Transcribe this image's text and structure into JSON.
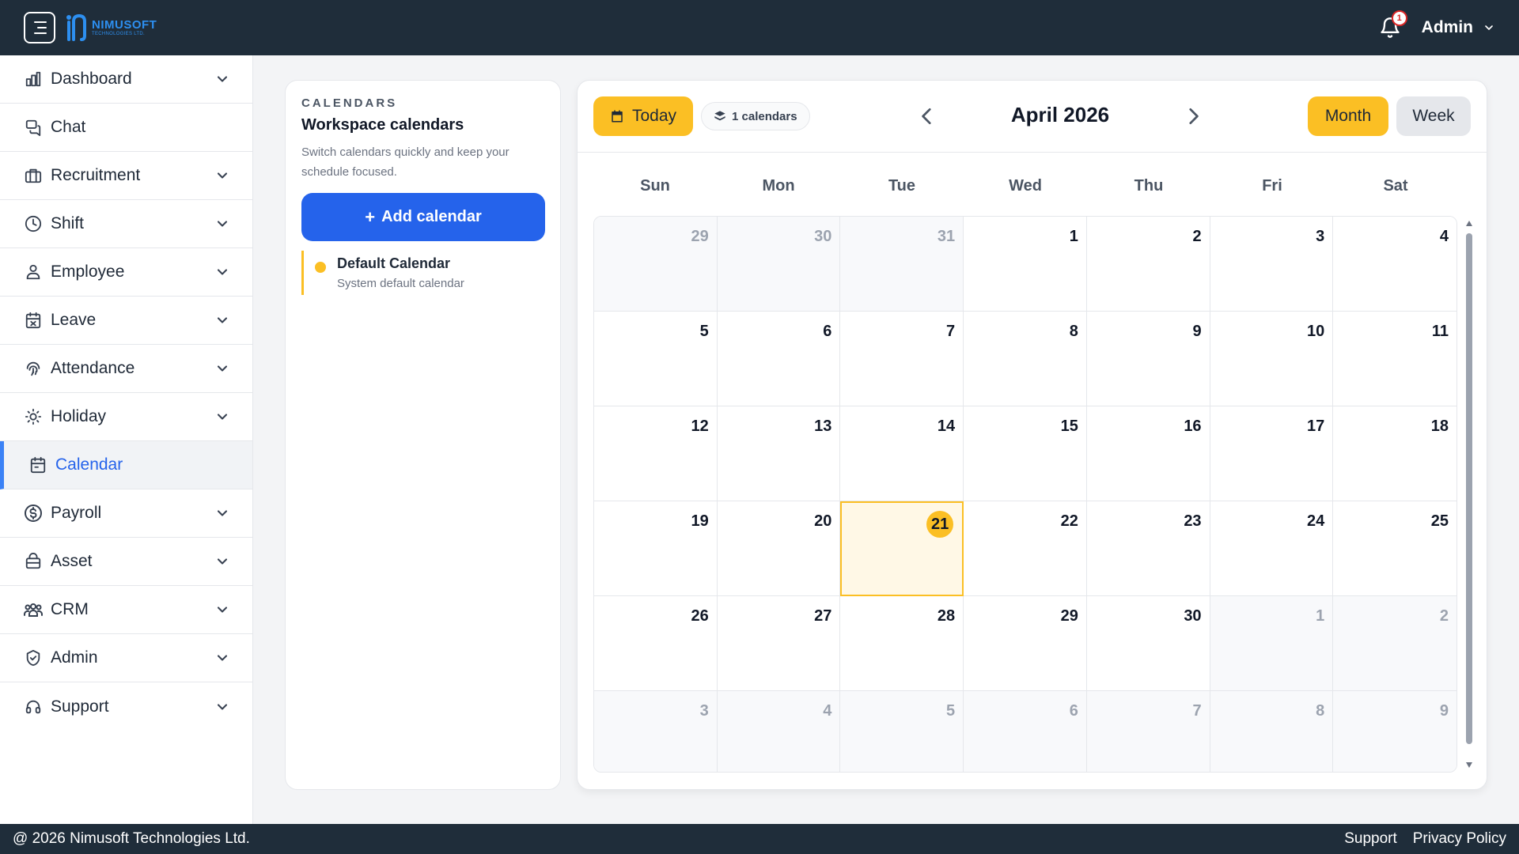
{
  "app": {
    "logo_name": "NIMUSOFT",
    "logo_sub": "TECHNOLOGIES LTD."
  },
  "topbar": {
    "notification_count": "1",
    "user_label": "Admin"
  },
  "sidebar": {
    "items": [
      {
        "label": "Dashboard",
        "icon": "chart-icon"
      },
      {
        "label": "Chat",
        "icon": "chat-icon"
      },
      {
        "label": "Recruitment",
        "icon": "briefcase-icon"
      },
      {
        "label": "Shift",
        "icon": "clock-icon"
      },
      {
        "label": "Employee",
        "icon": "user-icon"
      },
      {
        "label": "Leave",
        "icon": "calendar-x-icon"
      },
      {
        "label": "Attendance",
        "icon": "fingerprint-icon"
      },
      {
        "label": "Holiday",
        "icon": "sun-icon"
      },
      {
        "label": "Calendar",
        "icon": "calendar-icon"
      },
      {
        "label": "Payroll",
        "icon": "dollar-icon"
      },
      {
        "label": "Asset",
        "icon": "asset-icon"
      },
      {
        "label": "CRM",
        "icon": "users-icon"
      },
      {
        "label": "Admin",
        "icon": "shield-icon"
      },
      {
        "label": "Support",
        "icon": "headset-icon"
      }
    ]
  },
  "calendars_panel": {
    "eyebrow": "CALENDARS",
    "title": "Workspace calendars",
    "description": "Switch calendars quickly and keep your schedule focused.",
    "add_button": "Add calendar",
    "add_button_plus": "+",
    "entries": [
      {
        "name": "Default Calendar",
        "description": "System default calendar",
        "color": "#fbbf24"
      }
    ]
  },
  "calendar": {
    "today_label": "Today",
    "calendars_chip": "1 calendars",
    "month_title": "April 2026",
    "view_month": "Month",
    "view_week": "Week",
    "weekdays": [
      "Sun",
      "Mon",
      "Tue",
      "Wed",
      "Thu",
      "Fri",
      "Sat"
    ],
    "days": [
      {
        "n": "29",
        "out": true
      },
      {
        "n": "30",
        "out": true
      },
      {
        "n": "31",
        "out": true
      },
      {
        "n": "1"
      },
      {
        "n": "2"
      },
      {
        "n": "3"
      },
      {
        "n": "4"
      },
      {
        "n": "5"
      },
      {
        "n": "6"
      },
      {
        "n": "7"
      },
      {
        "n": "8"
      },
      {
        "n": "9"
      },
      {
        "n": "10"
      },
      {
        "n": "11"
      },
      {
        "n": "12"
      },
      {
        "n": "13"
      },
      {
        "n": "14"
      },
      {
        "n": "15"
      },
      {
        "n": "16"
      },
      {
        "n": "17"
      },
      {
        "n": "18"
      },
      {
        "n": "19"
      },
      {
        "n": "20"
      },
      {
        "n": "21",
        "today": true
      },
      {
        "n": "22"
      },
      {
        "n": "23"
      },
      {
        "n": "24"
      },
      {
        "n": "25"
      },
      {
        "n": "26"
      },
      {
        "n": "27"
      },
      {
        "n": "28"
      },
      {
        "n": "29"
      },
      {
        "n": "30"
      },
      {
        "n": "1",
        "out": true
      },
      {
        "n": "2",
        "out": true
      },
      {
        "n": "3",
        "out": true
      },
      {
        "n": "4",
        "out": true
      },
      {
        "n": "5",
        "out": true
      },
      {
        "n": "6",
        "out": true
      },
      {
        "n": "7",
        "out": true
      },
      {
        "n": "8",
        "out": true
      },
      {
        "n": "9",
        "out": true
      }
    ]
  },
  "footer": {
    "copyright": "@ 2026 Nimusoft Technologies Ltd.",
    "support": "Support",
    "privacy": "Privacy Policy"
  },
  "colors": {
    "topbar": "#1f2d3a",
    "accent": "#fbbf24",
    "primary": "#2563eb"
  }
}
